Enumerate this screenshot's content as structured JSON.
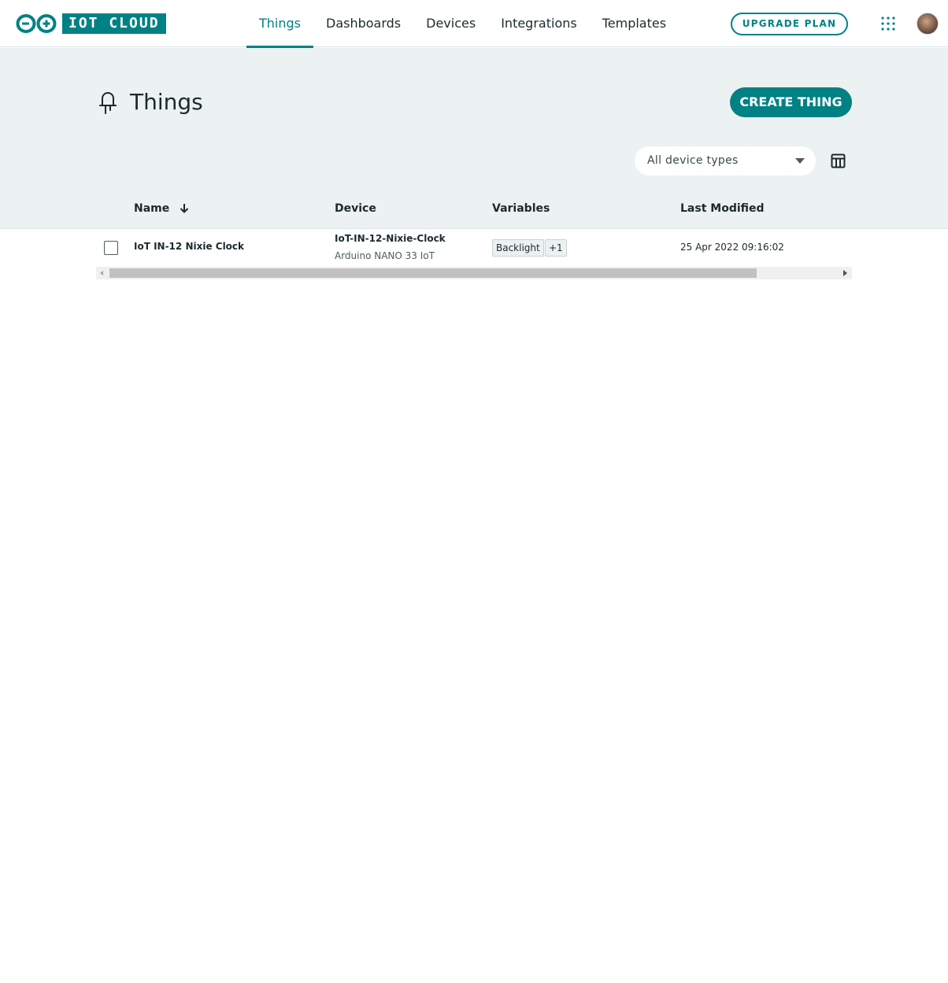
{
  "app": {
    "logo_text": "IOT CLOUD",
    "brand_color": "#008184"
  },
  "nav": {
    "items": [
      {
        "label": "Things",
        "active": true
      },
      {
        "label": "Dashboards",
        "active": false
      },
      {
        "label": "Devices",
        "active": false
      },
      {
        "label": "Integrations",
        "active": false
      },
      {
        "label": "Templates",
        "active": false
      }
    ]
  },
  "header": {
    "upgrade_label": "UPGRADE PLAN",
    "apps_icon": "grid-dots-icon",
    "avatar": "user-avatar"
  },
  "page": {
    "title": "Things",
    "title_icon": "thing-icon",
    "create_label": "CREATE THING",
    "filter_value": "All device types",
    "columns_icon": "table-columns-icon"
  },
  "table": {
    "columns": {
      "name": "Name",
      "device": "Device",
      "variables": "Variables",
      "last_modified": "Last Modified"
    },
    "sort": {
      "column": "Name",
      "direction": "descending"
    },
    "rows": [
      {
        "name": "IoT IN-12 Nixie Clock",
        "device": "IoT-IN-12-Nixie-Clock",
        "device_type": "Arduino NANO 33 IoT",
        "variables": [
          "Backlight",
          "+1"
        ],
        "last_modified": "25 Apr 2022 09:16:02"
      }
    ]
  }
}
